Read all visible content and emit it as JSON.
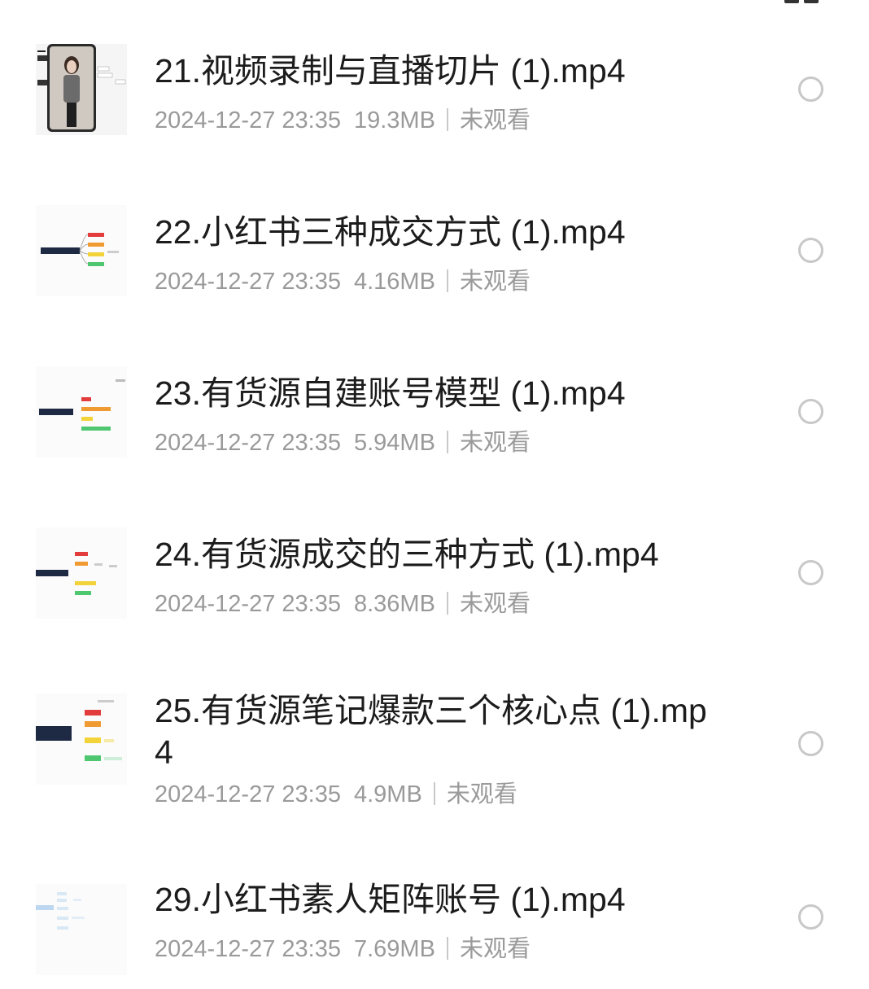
{
  "files": [
    {
      "name": "21.视频录制与直播切片 (1).mp4",
      "date": "2024-12-27 23:35",
      "size": "19.3MB",
      "status": "未观看"
    },
    {
      "name": "22.小红书三种成交方式 (1).mp4",
      "date": "2024-12-27 23:35",
      "size": "4.16MB",
      "status": "未观看"
    },
    {
      "name": "23.有货源自建账号模型 (1).mp4",
      "date": "2024-12-27 23:35",
      "size": "5.94MB",
      "status": "未观看"
    },
    {
      "name": "24.有货源成交的三种方式 (1).mp4",
      "date": "2024-12-27 23:35",
      "size": "8.36MB",
      "status": "未观看"
    },
    {
      "name": "25.有货源笔记爆款三个核心点 (1).mp4",
      "date": "2024-12-27 23:35",
      "size": "4.9MB",
      "status": "未观看"
    },
    {
      "name": "29.小红书素人矩阵账号 (1).mp4",
      "date": "2024-12-27 23:35",
      "size": "7.69MB",
      "status": "未观看"
    }
  ],
  "icons": {
    "view_toggle": "grid-view-icon",
    "select": "radio-unchecked-icon"
  },
  "colors": {
    "title": "#1c1c1c",
    "meta": "#9a9a9a",
    "radio_border": "#c8c8c8"
  }
}
